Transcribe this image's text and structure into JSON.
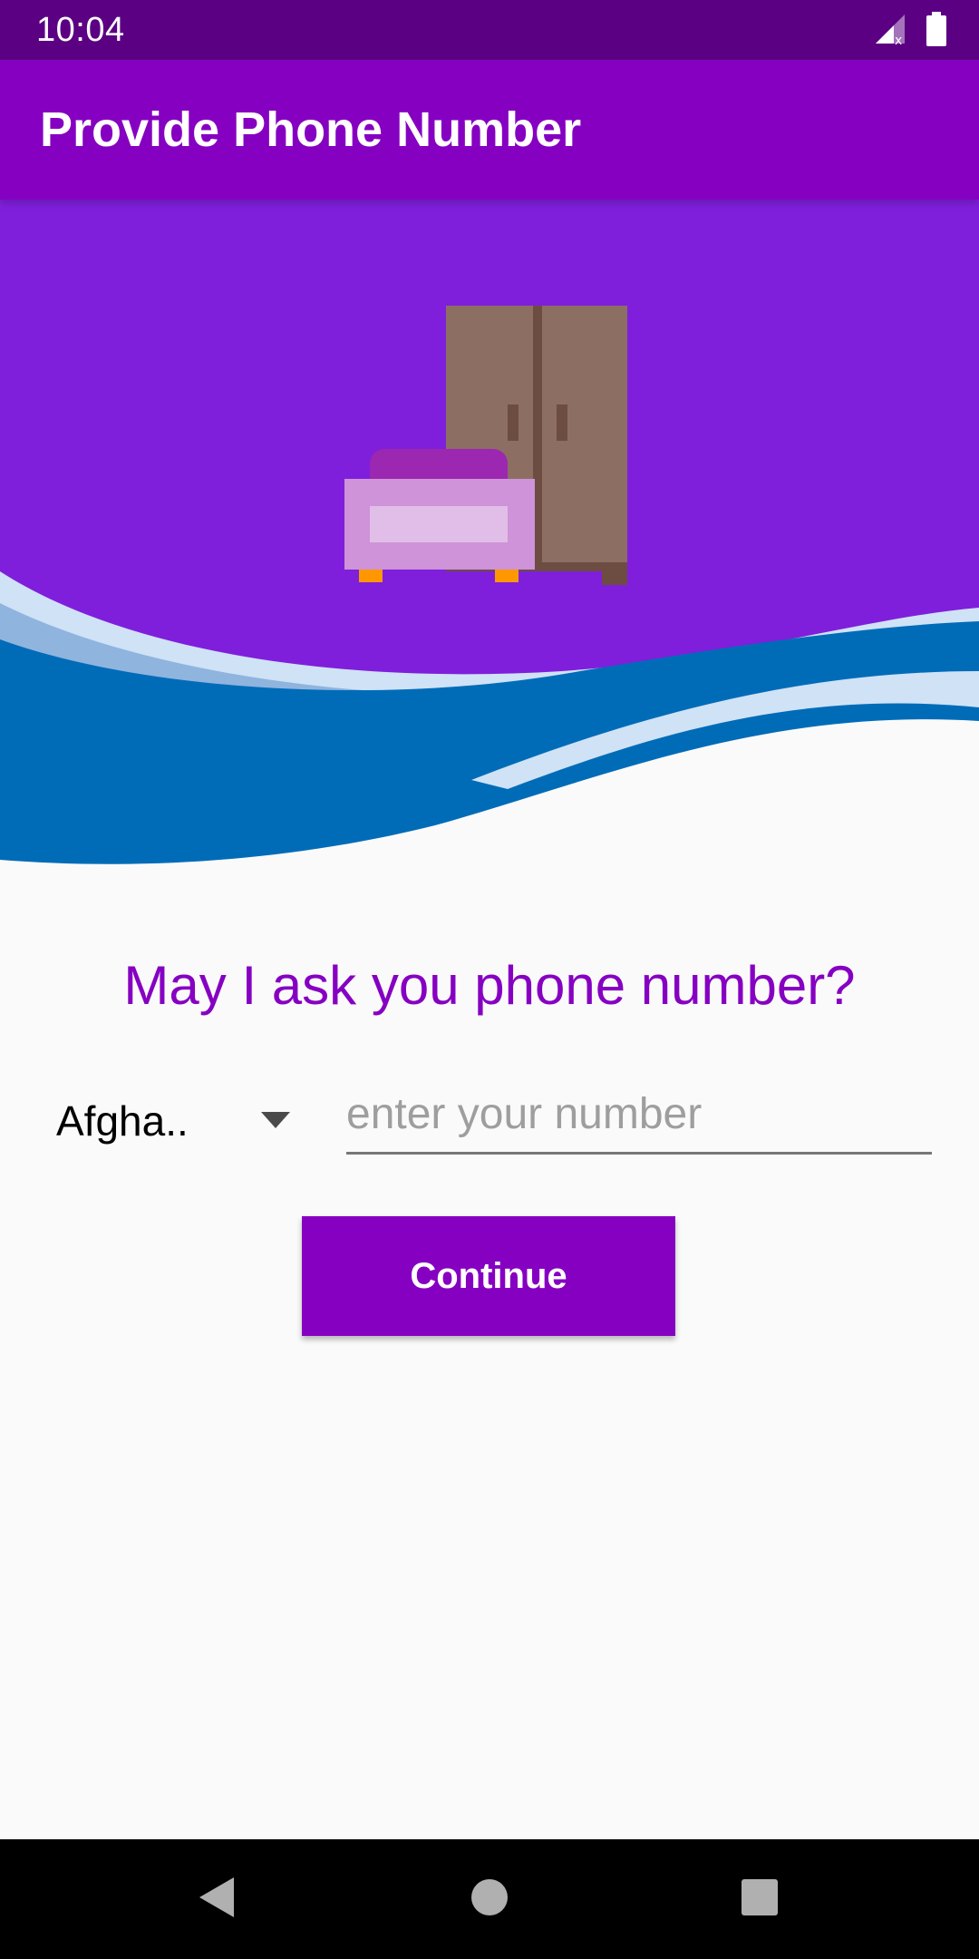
{
  "status_bar": {
    "time": "10:04",
    "icons": [
      "signal-no-data-icon",
      "battery-icon"
    ]
  },
  "app_bar": {
    "title": "Provide Phone Number"
  },
  "header": {
    "illustration": "furniture-illustration",
    "colors": {
      "background": "#7f1fdb",
      "wave_dark": "#006cb8",
      "wave_light": "#cfe2f6",
      "wave_mid": "#8fb4de"
    }
  },
  "form": {
    "question": "May I ask you phone number?",
    "country": {
      "selected": "Afgha.."
    },
    "phone": {
      "value": "",
      "placeholder": "enter your number"
    },
    "continue_label": "Continue"
  },
  "nav_bar": {
    "buttons": [
      "back-icon",
      "home-icon",
      "recents-icon"
    ]
  },
  "colors": {
    "primary": "#8600c2",
    "primary_dark": "#5b0083",
    "background": "#fafafa"
  }
}
